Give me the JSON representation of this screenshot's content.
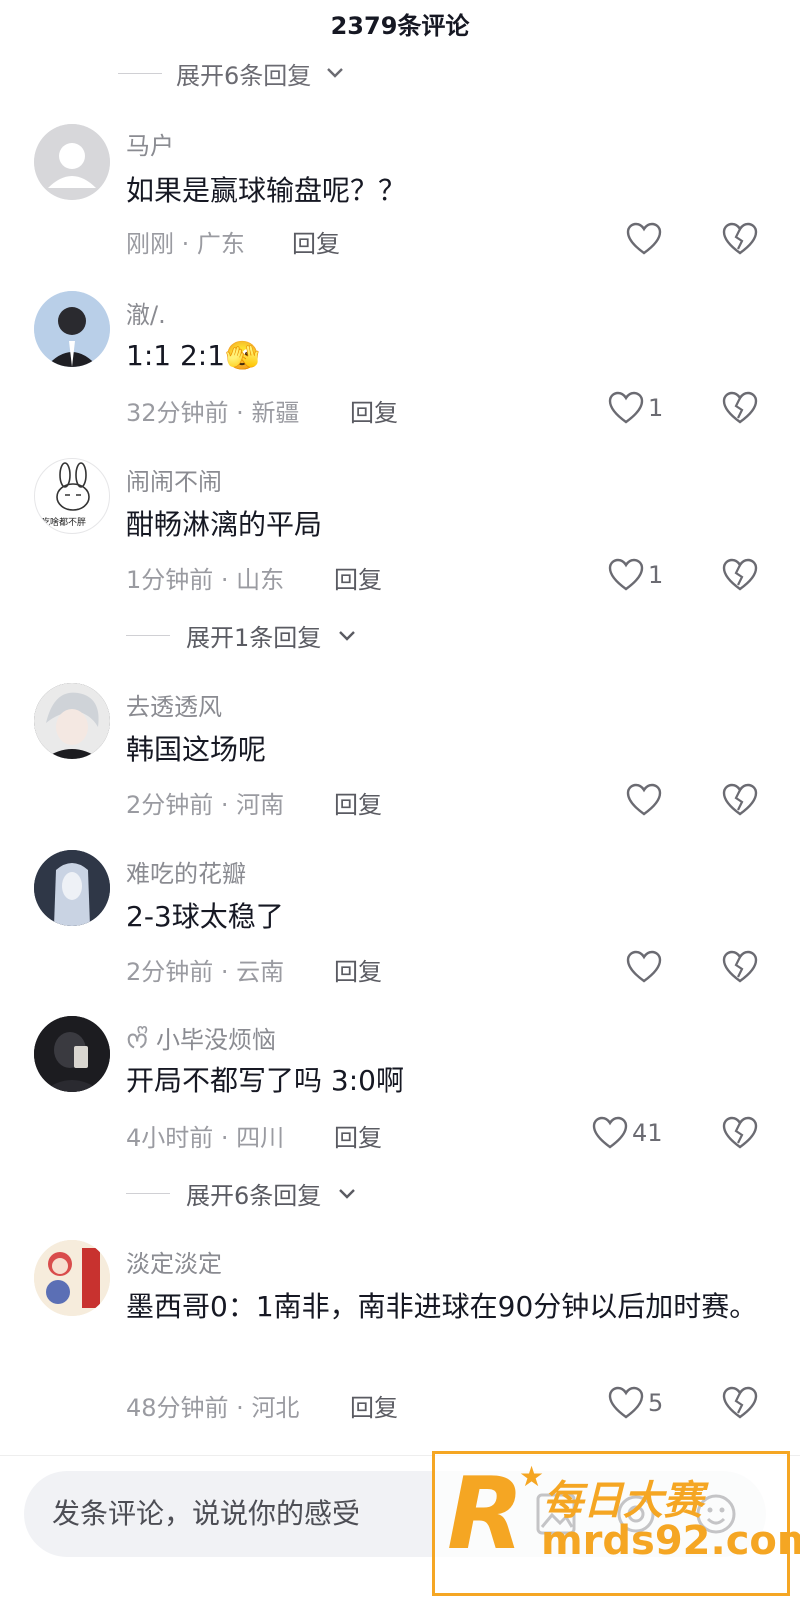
{
  "header": {
    "title": "2379条评论"
  },
  "partial_expand": {
    "label": "展开6条回复"
  },
  "comments": [
    {
      "user": "马户",
      "text": "如果是赢球输盘呢？？",
      "time": "刚刚",
      "location": "广东",
      "reply": "回复",
      "likes": ""
    },
    {
      "user": "澈/.",
      "text": "1:1 2:1",
      "emoji": "🫣",
      "time": "32分钟前",
      "location": "新疆",
      "reply": "回复",
      "likes": "1"
    },
    {
      "user": "闹闹不闹",
      "text": "酣畅淋漓的平局",
      "time": "1分钟前",
      "location": "山东",
      "reply": "回复",
      "likes": "1",
      "expand": "展开1条回复",
      "avatar_text": "吃啥都不胖"
    },
    {
      "user": "去透透风",
      "text": "韩国这场呢",
      "time": "2分钟前",
      "location": "河南",
      "reply": "回复",
      "likes": ""
    },
    {
      "user": "难吃的花瓣",
      "text": "2-3球太稳了",
      "time": "2分钟前",
      "location": "云南",
      "reply": "回复",
      "likes": ""
    },
    {
      "user": "小毕没烦恼",
      "badge": "ᰔᩚ",
      "text": "开局不都写了吗 3:0啊",
      "time": "4小时前",
      "location": "四川",
      "reply": "回复",
      "likes": "41",
      "expand": "展开6条回复"
    },
    {
      "user": "淡定淡定",
      "text": "墨西哥0：1南非，南非进球在90分钟以后加时赛。",
      "time": "48分钟前",
      "location": "河北",
      "reply": "回复",
      "likes": "5"
    }
  ],
  "composer": {
    "placeholder": "发条评论，说说你的感受"
  },
  "watermark": {
    "cn": "每日大赛",
    "url": "mrds92.com",
    "logo": "R"
  },
  "colors": {
    "text": "#161823",
    "meta": "#9a9ba1",
    "input_bg": "#f1f2f5",
    "watermark": "#f5a623"
  }
}
